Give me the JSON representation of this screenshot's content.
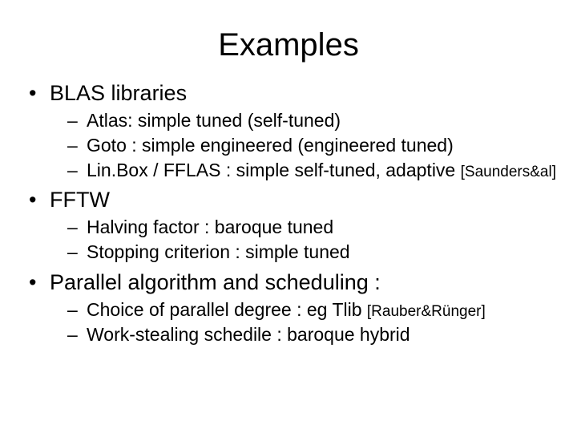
{
  "title": "Examples",
  "sections": [
    {
      "heading": "BLAS libraries",
      "items": [
        {
          "text": "Atlas: simple tuned (self-tuned)",
          "cite": ""
        },
        {
          "text": "Goto : simple engineered (engineered tuned)",
          "cite": ""
        },
        {
          "text": "Lin.Box / FFLAS : simple self-tuned, adaptive ",
          "cite": "[Saunders&al]"
        }
      ]
    },
    {
      "heading": "FFTW",
      "items": [
        {
          "text": "Halving factor : baroque tuned",
          "cite": ""
        },
        {
          "text": "Stopping criterion : simple tuned",
          "cite": ""
        }
      ]
    },
    {
      "heading": "Parallel algorithm and scheduling :",
      "items": [
        {
          "text": "Choice of parallel degree : eg Tlib ",
          "cite": "[Rauber&Rünger]"
        },
        {
          "text": "Work-stealing  schedile : baroque hybrid",
          "cite": ""
        }
      ]
    }
  ]
}
